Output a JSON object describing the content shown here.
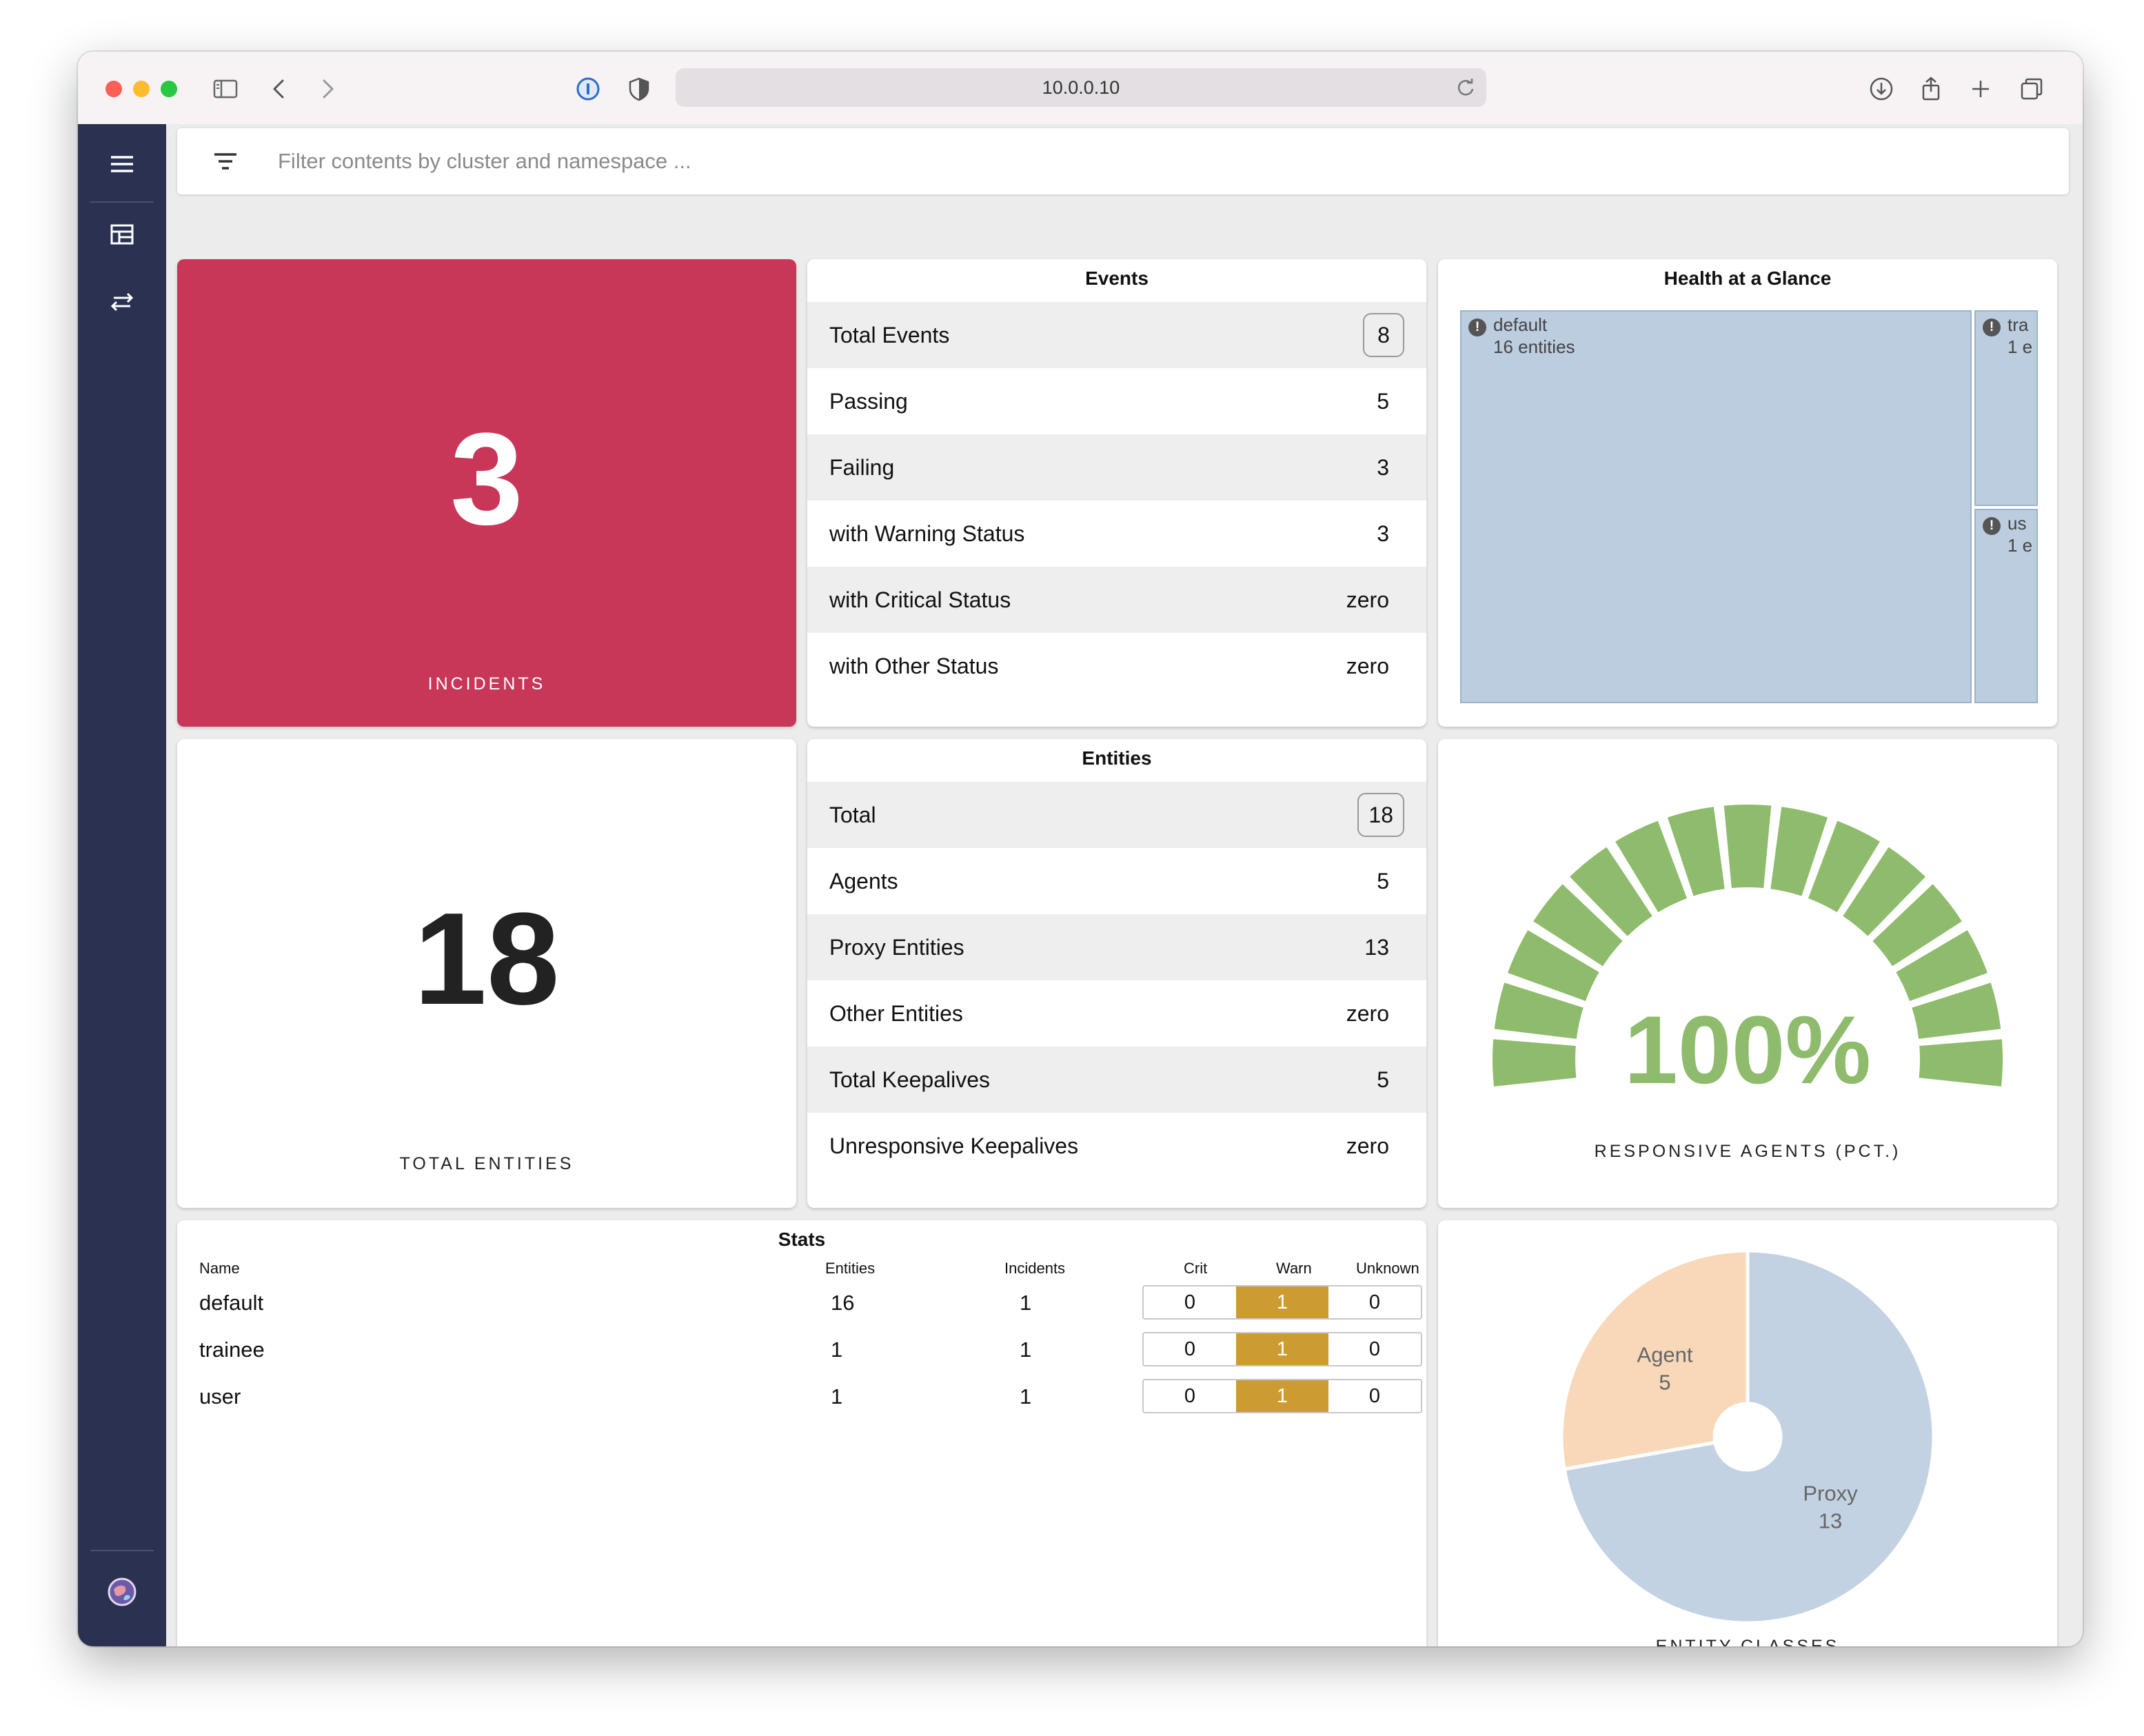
{
  "browser": {
    "url": "10.0.0.10"
  },
  "filter": {
    "placeholder": "Filter contents by cluster and namespace ..."
  },
  "incidents": {
    "value": "3",
    "caption": "INCIDENTS",
    "color": "#c83658"
  },
  "events": {
    "title": "Events",
    "rows": [
      {
        "label": "Total Events",
        "value": "8"
      },
      {
        "label": "Passing",
        "value": "5"
      },
      {
        "label": "Failing",
        "value": "3"
      },
      {
        "label": "with Warning Status",
        "value": "3"
      },
      {
        "label": "with Critical Status",
        "value": "zero"
      },
      {
        "label": "with Other Status",
        "value": "zero"
      }
    ]
  },
  "health": {
    "title": "Health at a Glance",
    "cells": [
      {
        "name": "default",
        "count": "16 entities"
      },
      {
        "name": "tra",
        "count": "1 e"
      },
      {
        "name": "us",
        "count": "1 e"
      }
    ]
  },
  "total_entities": {
    "value": "18",
    "caption": "TOTAL ENTITIES"
  },
  "entities": {
    "title": "Entities",
    "rows": [
      {
        "label": "Total",
        "value": "18"
      },
      {
        "label": "Agents",
        "value": "5"
      },
      {
        "label": "Proxy Entities",
        "value": "13"
      },
      {
        "label": "Other Entities",
        "value": "zero"
      },
      {
        "label": "Total Keepalives",
        "value": "5"
      },
      {
        "label": "Unresponsive Keepalives",
        "value": "zero"
      }
    ]
  },
  "responsive": {
    "value": "100%",
    "percent": 100,
    "segments": 15,
    "caption": "RESPONSIVE AGENTS (PCT.)",
    "color": "#8fbb6c"
  },
  "stats": {
    "title": "Stats",
    "headers": {
      "name": "Name",
      "entities": "Entities",
      "incidents": "Incidents",
      "crit": "Crit",
      "warn": "Warn",
      "unknown": "Unknown"
    },
    "rows": [
      {
        "name": "default",
        "entities": "16",
        "incidents": "1",
        "crit": "0",
        "warn": "1",
        "unknown": "0"
      },
      {
        "name": "trainee",
        "entities": "1",
        "incidents": "1",
        "crit": "0",
        "warn": "1",
        "unknown": "0"
      },
      {
        "name": "user",
        "entities": "1",
        "incidents": "1",
        "crit": "0",
        "warn": "1",
        "unknown": "0"
      }
    ],
    "warn_color": "#cc9c32"
  },
  "entity_classes": {
    "caption": "ENTITY CLASSES",
    "slices": [
      {
        "label": "Agent",
        "value": "5",
        "color": "#f8d8b8"
      },
      {
        "label": "Proxy",
        "value": "13",
        "color": "#c3d2e2"
      }
    ]
  },
  "chart_data": {
    "type": "pie",
    "categories": [
      "Agent",
      "Proxy"
    ],
    "values": [
      5,
      13
    ]
  }
}
